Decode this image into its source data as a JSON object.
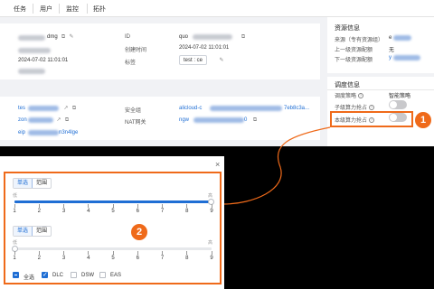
{
  "tabs": [
    "任务",
    "用户",
    "监控",
    "拓扑"
  ],
  "info": {
    "id_label": "ID",
    "id_value_prefix": "quo",
    "created_label": "创建时间",
    "created_value": "2024-07-02 11:01:01",
    "tags_label": "标签",
    "tag_value": "test : ce",
    "left_suffix": "dmg",
    "left_time": "2024-07-02 11:01:01"
  },
  "resource": {
    "title": "资源信息",
    "source_label": "来源（专有资源组）",
    "upstream_label": "上一级资源配额",
    "upstream_value": "无",
    "downstream_label": "下一级资源配额",
    "downstream_value_prefix": "y"
  },
  "network": {
    "link1": "tes",
    "link2": "zon",
    "link3_prefix": "eip",
    "link3_suffix": "n3n4lge",
    "security_label": "安全组",
    "security_value": "alicloud-c",
    "security_suffix": "7eb8c3a...",
    "nat_label": "NAT网关",
    "nat_value": "ngw",
    "nat_suffix": "0"
  },
  "schedule": {
    "title": "调度信息",
    "policy_label": "调度策略",
    "policy_value": "智能策略",
    "sub_preempt_label": "子级算力抢占",
    "this_preempt_label": "本级算力抢占"
  },
  "badges": [
    "1",
    "2"
  ],
  "dialog": {
    "seg1": [
      "单选",
      "范围"
    ],
    "hint1": "低",
    "hint1_right": "高",
    "seg2": [
      "单选",
      "范围"
    ],
    "hint2": "低",
    "hint2_right": "高",
    "ticks": [
      "1",
      "2",
      "3",
      "4",
      "5",
      "6",
      "7",
      "8",
      "9"
    ],
    "checks": [
      "全选",
      "DLC",
      "DSW",
      "EAS"
    ],
    "close": "×"
  }
}
